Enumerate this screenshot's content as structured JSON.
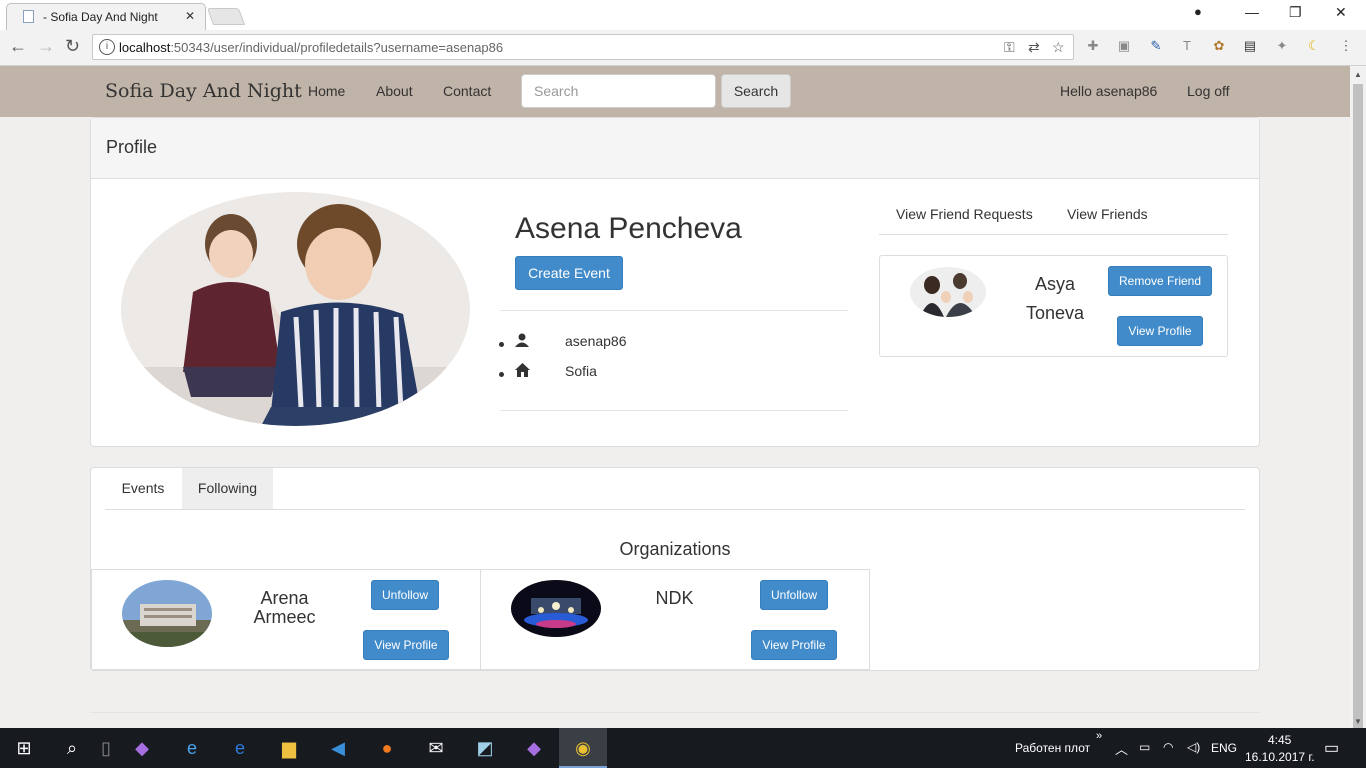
{
  "browser": {
    "tab_title": "- Sofia Day And Night",
    "url_host": "localhost",
    "url_rest": ":50343/user/individual/profiledetails?username=asenap86"
  },
  "site": {
    "brand": "Sofia Day And Night",
    "nav": [
      "Home",
      "About",
      "Contact"
    ],
    "search_placeholder": "Search",
    "search_button": "Search",
    "greeting": "Hello asenap86",
    "logoff": "Log off"
  },
  "profile": {
    "heading": "Profile",
    "full_name": "Asena Pencheva",
    "create_event": "Create Event",
    "username": "asenap86",
    "city": "Sofia",
    "friend_tabs": [
      "View Friend Requests",
      "View Friends"
    ],
    "friend": {
      "first_name": "Asya",
      "last_name": "Toneva",
      "remove_label": "Remove Friend",
      "view_label": "View Profile"
    }
  },
  "following": {
    "tabs": [
      "Events",
      "Following"
    ],
    "active_tab": "Following",
    "section_title": "Organizations",
    "organizations": [
      {
        "name_line1": "Arena",
        "name_line2": "Armeec",
        "unfollow": "Unfollow",
        "view": "View Profile"
      },
      {
        "name_line1": "NDK",
        "name_line2": "",
        "unfollow": "Unfollow",
        "view": "View Profile"
      }
    ]
  },
  "taskbar": {
    "tray_label": "Работен плот",
    "language": "ENG",
    "time": "4:45",
    "date": "16.10.2017 г."
  },
  "colors": {
    "navbar_bg": "#c0b3a7",
    "primary": "#428bca",
    "page_bg": "#f1efed"
  }
}
